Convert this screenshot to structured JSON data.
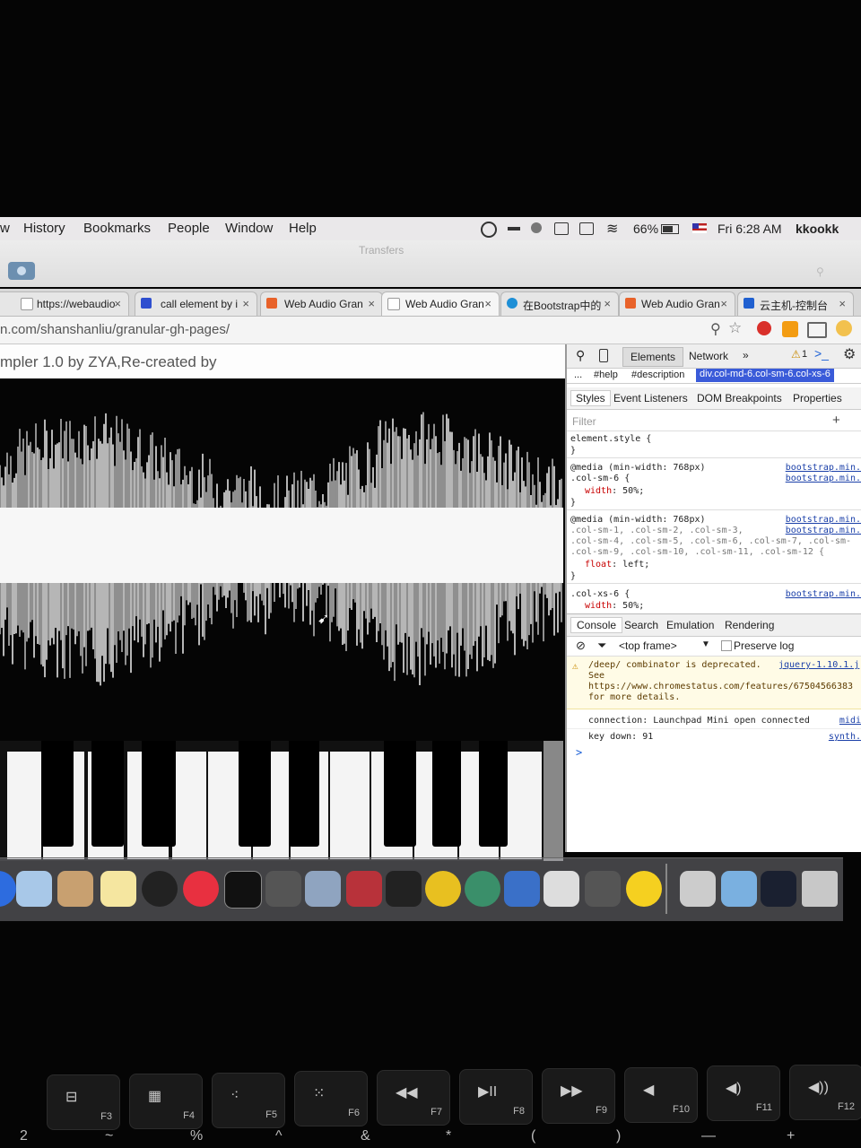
{
  "menubar": {
    "items": [
      "w",
      "History",
      "Bookmarks",
      "People",
      "Window",
      "Help"
    ],
    "battery": "66%",
    "clock": "Fri 6:28 AM",
    "user": "kkookk"
  },
  "transfers": {
    "title": "Transfers"
  },
  "tabs": [
    {
      "label": "https://webaudio",
      "close": "×",
      "icon": "page-icon"
    },
    {
      "label": "call element by i",
      "close": "×",
      "icon": "baidu-paw-icon"
    },
    {
      "label": "Web Audio Gran",
      "close": "×",
      "icon": "site-icon"
    },
    {
      "label": "Web Audio Gran",
      "close": "×",
      "icon": "page-icon"
    },
    {
      "label": "在Bootstrap中的",
      "close": "×",
      "icon": "ie-icon"
    },
    {
      "label": "Web Audio Gran",
      "close": "×",
      "icon": "site-icon"
    },
    {
      "label": "云主机-控制台",
      "close": "×",
      "icon": "cloud-icon"
    }
  ],
  "address": {
    "url": "n.com/shanshanliu/granular-gh-pages/"
  },
  "page": {
    "title": "mpler 1.0 by ZYA,Re-created by"
  },
  "devtools": {
    "tabs": [
      "Elements",
      "Network",
      "»"
    ],
    "warning_count": "1",
    "breadcrumbs": [
      "...",
      "#help",
      "#description",
      "div.col-md-6.col-sm-6.col-xs-6"
    ],
    "style_tabs": [
      "Styles",
      "Event Listeners",
      "DOM Breakpoints",
      "Properties"
    ],
    "filter_placeholder": "Filter",
    "rules": {
      "element_style": "element.style {",
      "close_brace": "}",
      "media": "@media (min-width: 768px)",
      "sel1": ".col-sm-6 {",
      "prop1": "width",
      "val1": "50%;",
      "sel2a": ".col-sm-1, .col-sm-2, .col-sm-3,",
      "sel2b": ".col-sm-4, .col-sm-5, .col-sm-6, .col-sm-7, .col-sm-",
      "sel2c": ".col-sm-9, .col-sm-10, .col-sm-11, .col-sm-12 {",
      "prop2": "float",
      "val2": "left;",
      "sel3": ".col-xs-6 {",
      "prop3": "width",
      "val3": "50%;",
      "source": "bootstrap.min."
    },
    "console_tabs": [
      "Console",
      "Search",
      "Emulation",
      "Rendering"
    ],
    "frame": "<top frame>",
    "preserve_log": "Preserve log",
    "warning_msg": "/deep/ combinator is deprecated.",
    "warning_see": "See",
    "warning_url": "https://www.chromestatus.com/features/67504566383",
    "warning_more": "for more details.",
    "warning_src": "jquery-1.10.1.j",
    "log1": "connection: Launchpad Mini open connected",
    "log1_src": "midi",
    "log2": "key down: 91",
    "log2_src": "synth.",
    "prompt": ">"
  },
  "keyboard": {
    "keys": [
      {
        "sym": "⊟",
        "label": "F3"
      },
      {
        "sym": "▦",
        "label": "F4"
      },
      {
        "sym": "⁖",
        "label": "F5"
      },
      {
        "sym": "⁙",
        "label": "F6"
      },
      {
        "sym": "◀◀",
        "label": "F7"
      },
      {
        "sym": "▶II",
        "label": "F8"
      },
      {
        "sym": "▶▶",
        "label": "F9"
      },
      {
        "sym": "◀",
        "label": "F10"
      },
      {
        "sym": "◀)",
        "label": "F11"
      },
      {
        "sym": "◀))",
        "label": "F12"
      }
    ],
    "row2": [
      "2",
      "~",
      "%",
      "^",
      "&",
      "*",
      "(",
      ")",
      "—",
      "+"
    ]
  },
  "colors": {
    "accent": "#1a73e8",
    "devtools_selected": "#3a5bd9",
    "warning_bg": "#fffbe6"
  }
}
